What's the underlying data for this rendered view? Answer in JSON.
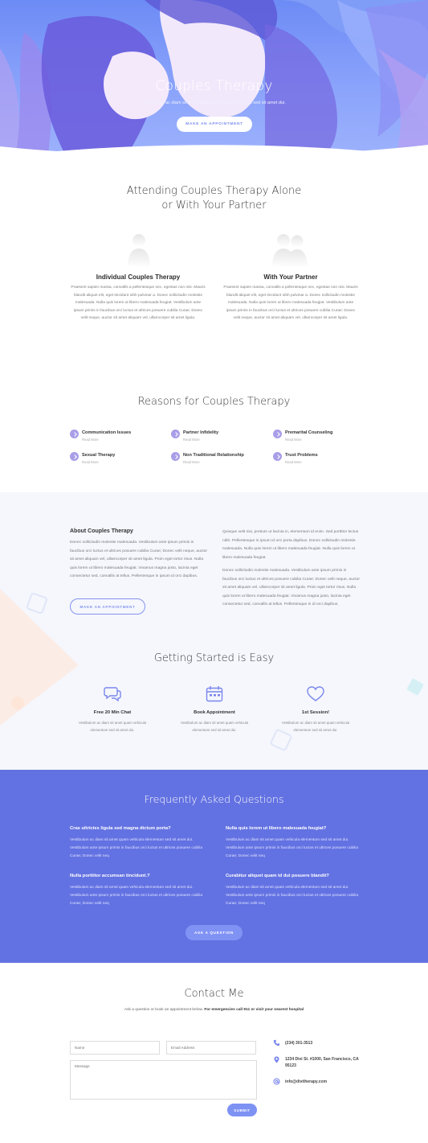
{
  "hero": {
    "title": "Couples Therapy",
    "subtitle": "Vestibulum ac diam sit amet quam vehicula elementum sed sit amet dui.",
    "button": "MAKE AN APPOINTMENT"
  },
  "attending": {
    "title_line1": "Attending Couples Therapy Alone",
    "title_line2": "or With Your Partner",
    "columns": [
      {
        "title": "Individual Couples Therapy",
        "text": "Praesent sapien massa, convallis a pellentesque nec, egestas non nisi. Mauris blandit aliquet elit, eget tincidunt nibh pulvinar a. Donec sollicitudin molestie malesuada. Nulla quis lorem ut libero malesuada feugiat. Vestibulum ante ipsum primis in faucibus orci luctus et ultrices posuere cubilia Curae; Donec velit neque, auctor sit amet aliquam vel, ullamcorper sit amet ligula."
      },
      {
        "title": "With Your Partner",
        "text": "Praesent sapien massa, convallis a pellentesque nec, egestas non nisi. Mauris blandit aliquet elit, eget tincidunt nibh pulvinar a. Donec sollicitudin molestie malesuada. Nulla quis lorem ut libero malesuada feugiat. Vestibulum ante ipsum primis in faucibus orci luctus et ultrices posuere cubilia Curae; Donec velit neque, auctor sit amet aliquam vel, ullamcorper sit amet ligula."
      }
    ]
  },
  "reasons": {
    "title": "Reasons for Couples Therapy",
    "more_label": "Read More",
    "items": [
      {
        "label": "Communication Issues"
      },
      {
        "label": "Partner Infidelity"
      },
      {
        "label": "Premarital Counseling"
      },
      {
        "label": "Sexual Therapy"
      },
      {
        "label": "Non Traditional Relationship"
      },
      {
        "label": "Trust Problems"
      }
    ]
  },
  "about": {
    "title": "About Couples Therapy",
    "p1": "Donec sollicitudin molestie malesuada. Vestibulum ante ipsum primis in faucibus orci luctus et ultrices posuere cubilia Curae; Donec velit neque, auctor sit amet aliquam vel, ullamcorper sit amet ligula. Proin eget tortor risus. Nulla quis lorem ut libero malesuada feugiat. Vivamus magna justo, lacinia eget consectetur sed, convallis at tellus. Pellentesque in ipsum id orci dapibus.",
    "p2": "Quisque velit nisi, pretium ut lacinia in, elementum id enim. Sed porttitor lectus nibh. Pellentesque in ipsum id orci porta dapibus. Donec sollicitudin molestie malesuada. Nulla quis lorem ut libero malesuada feugiat. Nulla quis lorem ut libero malesuada feugiat.",
    "p3": "Donec sollicitudin molestie malesuada. Vestibulum ante ipsum primis in faucibus orci luctus et ultrices posuere cubilia Curae; Donec velit neque, auctor sit amet aliquam vel, ullamcorper sit amet ligula. Proin eget tortor risus. Nulla quis lorem ut libero malesuada feugiat. Vivamus magna justo, lacinia eget consectetur sed, convallis at tellus. Pellentesque in id orci dapibus.",
    "button": "MAKE AN APPOINTMENT"
  },
  "getting_started": {
    "title": "Getting Started is Easy",
    "steps": [
      {
        "icon": "chat-icon",
        "title": "Free 20 Min Chat",
        "text": "Vestibulum ac diam sit amet quam vehicula elementum sed sit amet dui."
      },
      {
        "icon": "calendar-icon",
        "title": "Book Appointment",
        "text": "Vestibulum ac diam sit amet quam vehicula elementum sed sit amet dui."
      },
      {
        "icon": "heart-icon",
        "title": "1st Session!",
        "text": "Vestibulum ac diam sit amet quam vehicula elementum sed sit amet dui."
      }
    ]
  },
  "faq": {
    "title": "Frequently Asked Questions",
    "items": [
      {
        "q": "Cras ultricies ligula sed magna dictum porta?",
        "a": "Vestibulum ac diam sit amet quam vehicula elementum sed sit amet dui. Vestibulum ante ipsum primis in faucibus orci luctus et ultrices posuere cubilia Curae; Donec velit neq"
      },
      {
        "q": "Nulla quis lorem ut libero malesuada feugiat?",
        "a": "Vestibulum ac diam sit amet quam vehicula elementum sed sit amet dui. Vestibulum ante ipsum primis in faucibus orci luctus et ultrices posuere cubilia Curae; Donec velit neq"
      },
      {
        "q": "Nulla porttitor accumsan tincidunt.?",
        "a": "Vestibulum ac diam sit amet quam vehicula elementum sed sit amet dui. Vestibulum ante ipsum primis in faucibus orci luctus et ultrices posuere cubilia Curae; Donec velit neq"
      },
      {
        "q": "Curabitur aliquet quam id dui posuere blandit?",
        "a": "Vestibulum ac diam sit amet quam vehicula elementum sed sit amet dui. Vestibulum ante ipsum primis in faucibus orci luctus et ultrices posuere cubilia Curae; Donec velit neq"
      }
    ],
    "button": "ASK A QUESTION"
  },
  "contact": {
    "title": "Contact Me",
    "sub_plain": "Ask a question or book an appointment below.",
    "sub_bold": "For emergencies call 911 or visit your nearest hospital",
    "name_placeholder": "Name",
    "email_placeholder": "Email Address",
    "message_placeholder": "Message",
    "submit": "SUBMIT",
    "phone": "(234) 301-3513",
    "address": "1234 Divi St. #1000, San Francisco, CA 95123",
    "email": "info@divitherapy.com"
  },
  "colors": {
    "accent": "#6372e2",
    "hero_blue": "#7b8cf0",
    "bullet": "#a89ee8"
  }
}
